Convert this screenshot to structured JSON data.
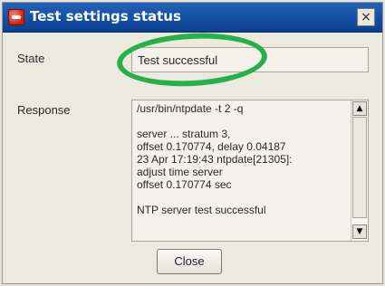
{
  "window": {
    "title": "Test settings status",
    "close_glyph": "×",
    "app_icon": "app-icon"
  },
  "form": {
    "state_label": "State",
    "state_value": "Test successful",
    "response_label": "Response",
    "response_lines": [
      "/usr/bin/ntpdate -t 2 -q",
      "",
      "server ... stratum 3,",
      "offset 0.170774, delay 0.04187",
      "23 Apr 17:19:43 ntpdate[21305]:",
      "adjust time server",
      "offset 0.170774 sec",
      "",
      "NTP server test successful"
    ]
  },
  "scrollbar": {
    "up_glyph": "▲",
    "down_glyph": "▼"
  },
  "buttons": {
    "close_label": "Close"
  },
  "colors": {
    "titlebar": "#1a5bb2",
    "annotation_circle": "#25b04a"
  }
}
